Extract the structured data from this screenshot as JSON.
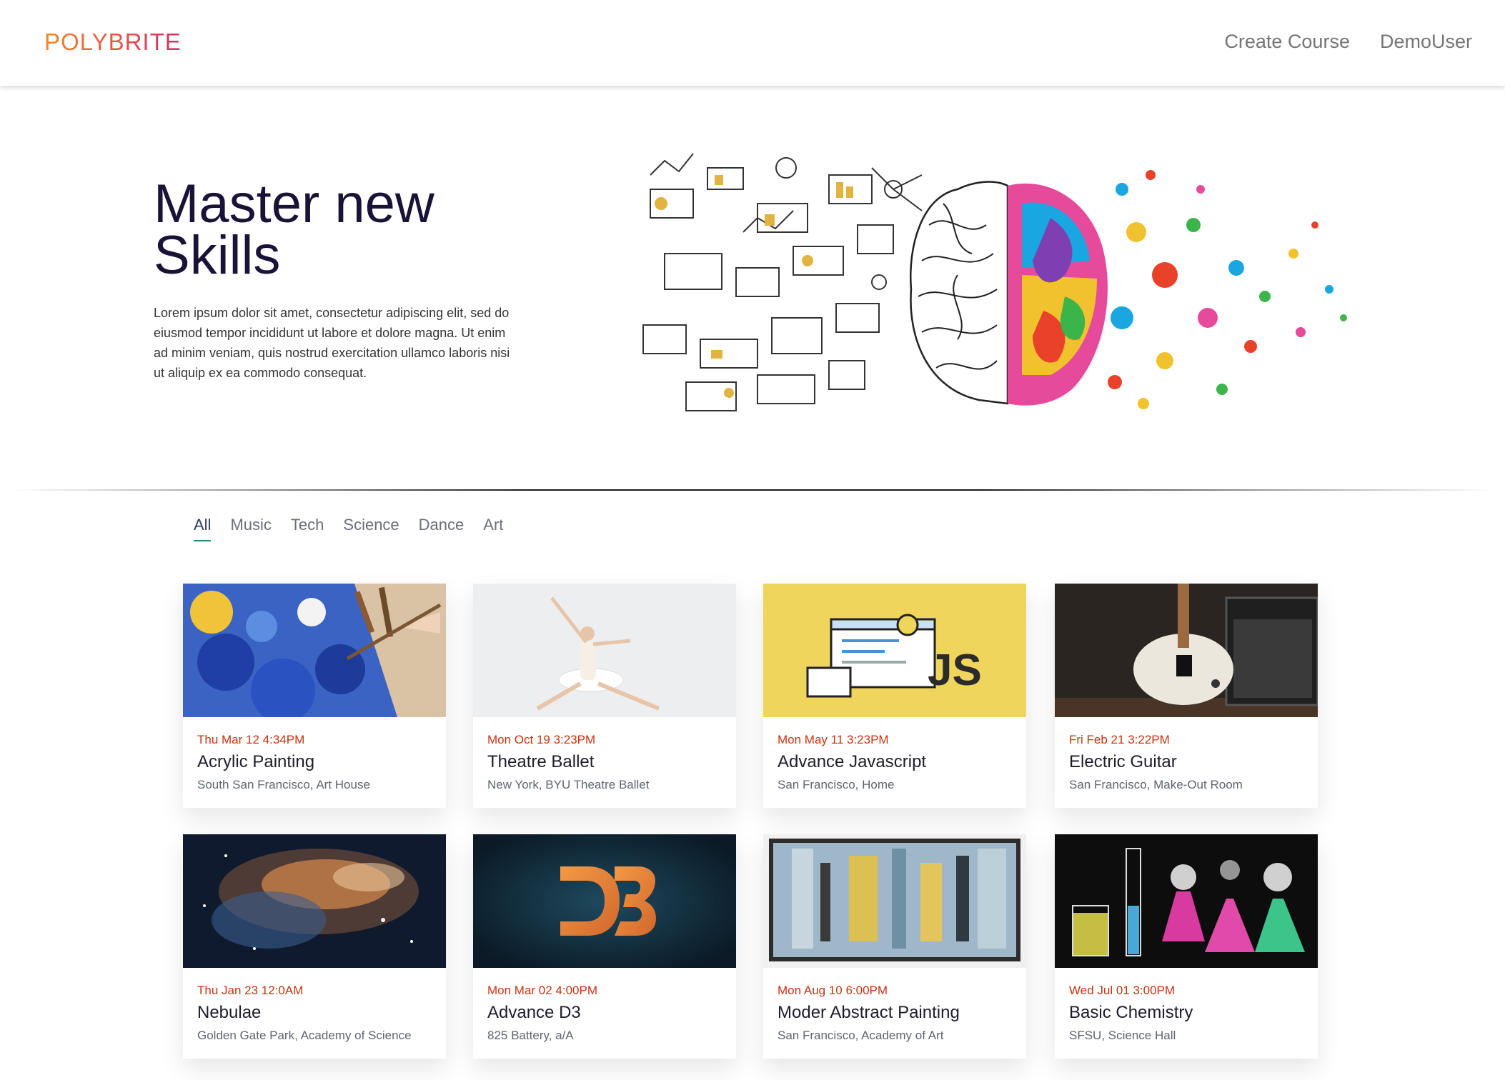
{
  "brand": {
    "logo": "POLYBRITE"
  },
  "nav": {
    "create_course": "Create Course",
    "user": "DemoUser"
  },
  "hero": {
    "title": "Master new Skills",
    "text": "Lorem ipsum dolor sit amet, consectetur adipiscing elit, sed do eiusmod tempor incididunt ut labore et dolore magna. Ut enim ad minim veniam, quis nostrud exercitation ullamco laboris nisi ut aliquip ex ea commodo consequat."
  },
  "tabs": [
    {
      "label": "All",
      "active": true
    },
    {
      "label": "Music"
    },
    {
      "label": "Tech"
    },
    {
      "label": "Science"
    },
    {
      "label": "Dance"
    },
    {
      "label": "Art"
    }
  ],
  "courses": [
    {
      "date": "Thu Mar 12 4:34PM",
      "title": "Acrylic Painting",
      "place": "South San Francisco, Art House",
      "image": "acrylic-painting"
    },
    {
      "date": "Mon Oct 19 3:23PM",
      "title": "Theatre Ballet",
      "place": "New York, BYU Theatre Ballet",
      "image": "ballet-dancer"
    },
    {
      "date": "Mon May 11 3:23PM",
      "title": "Advance Javascript",
      "place": "San Francisco, Home",
      "image": "javascript-logo",
      "image_text": "JS"
    },
    {
      "date": "Fri Feb 21 3:22PM",
      "title": "Electric Guitar",
      "place": "San Francisco, Make-Out Room",
      "image": "electric-guitar"
    },
    {
      "date": "Thu Jan 23 12:0AM",
      "title": "Nebulae",
      "place": "Golden Gate Park, Academy of Science",
      "image": "nebula"
    },
    {
      "date": "Mon Mar 02 4:00PM",
      "title": "Advance D3",
      "place": "825 Battery, a/A",
      "image": "d3-logo"
    },
    {
      "date": "Mon Aug 10 6:00PM",
      "title": "Moder Abstract Painting",
      "place": "San Francisco, Academy of Art",
      "image": "abstract-painting"
    },
    {
      "date": "Wed Jul 01 3:00PM",
      "title": "Basic Chemistry",
      "place": "SFSU, Science Hall",
      "image": "chemistry-flasks"
    }
  ],
  "colors": {
    "accent": "#1a8f76",
    "date": "#c7330f",
    "title": "#1a1237"
  }
}
